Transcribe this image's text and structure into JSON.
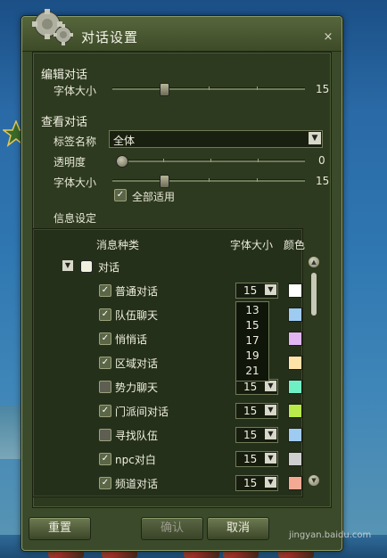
{
  "window": {
    "title": "对话设置",
    "close_icon": "×"
  },
  "edit_section": {
    "heading": "编辑对话",
    "font_size_label": "字体大小",
    "font_size_value": "15",
    "font_size_fraction": 0.32
  },
  "view_section": {
    "heading": "查看对话",
    "tab_name_label": "标签名称",
    "tab_name_value": "全体",
    "opacity_label": "透明度",
    "opacity_value": "0",
    "opacity_fraction": 0.0,
    "font_size_label": "字体大小",
    "font_size_value": "15",
    "font_size_fraction": 0.26,
    "apply_all_label": "全部适用",
    "apply_all_checked": true
  },
  "info": {
    "heading": "信息设定",
    "col_type": "消息种类",
    "col_size": "字体大小",
    "col_color": "颜色",
    "group_label": "对话",
    "rows": [
      {
        "label": "普通对话",
        "checked": true,
        "size": "15",
        "color": "#ffffff"
      },
      {
        "label": "队伍聊天",
        "checked": true,
        "size": "",
        "color": "#9ecbf2"
      },
      {
        "label": "悄悄话",
        "checked": true,
        "size": "",
        "color": "#e2b4f2"
      },
      {
        "label": "区域对话",
        "checked": true,
        "size": "",
        "color": "#fde3a7"
      },
      {
        "label": "势力聊天",
        "checked": false,
        "size": "15",
        "color": "#6ff0c4"
      },
      {
        "label": "门派间对话",
        "checked": true,
        "size": "15",
        "color": "#b7ea4a"
      },
      {
        "label": "寻找队伍",
        "checked": false,
        "size": "15",
        "color": "#9ecbf2"
      },
      {
        "label": "npc对白",
        "checked": true,
        "size": "15",
        "color": "#cfcfcf"
      },
      {
        "label": "频道对话",
        "checked": true,
        "size": "15",
        "color": "#f3a994"
      }
    ],
    "size_options": [
      "13",
      "15",
      "17",
      "19",
      "21"
    ]
  },
  "buttons": {
    "reset": "重置",
    "confirm": "确认",
    "cancel": "取消"
  },
  "watermark": "jingyan.baidu.com"
}
